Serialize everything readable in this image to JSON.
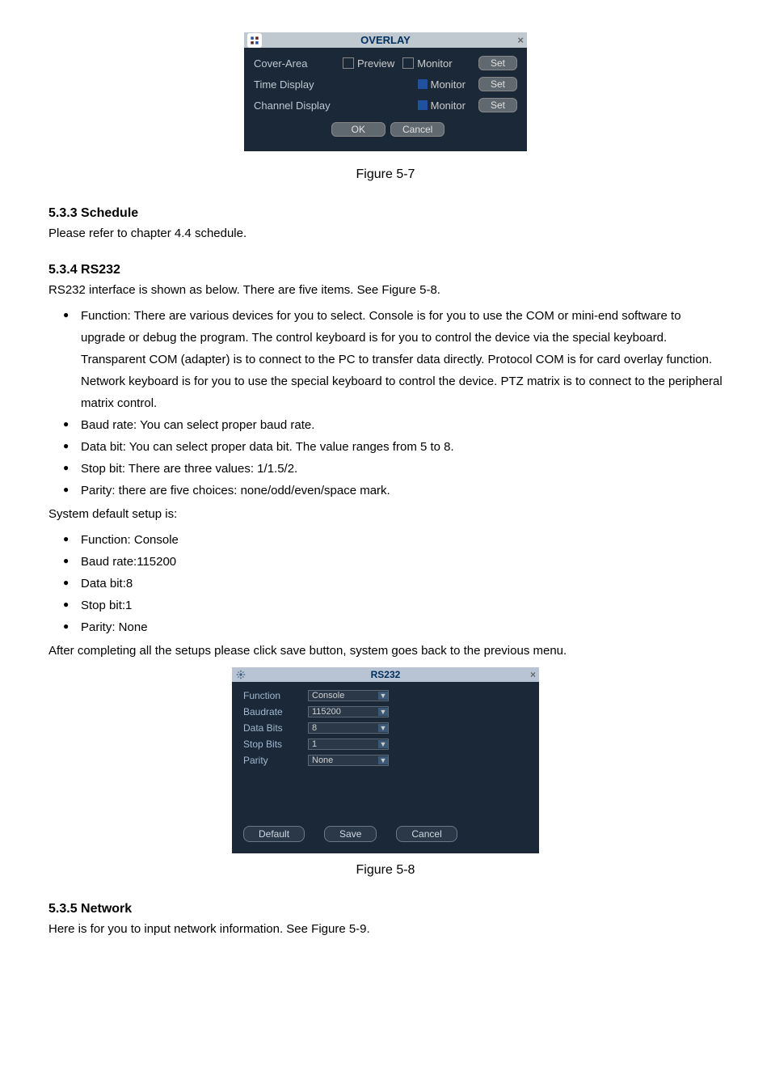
{
  "overlay_dialog": {
    "title": "OVERLAY",
    "cover_area_label": "Cover-Area",
    "preview_label": "Preview",
    "monitor_label": "Monitor",
    "time_display_label": "Time Display",
    "channel_display_label": "Channel Display",
    "set_btn": "Set",
    "ok_btn": "OK",
    "cancel_btn": "Cancel"
  },
  "caption1": "Figure 5-7",
  "s533": {
    "heading": "5.3.3  Schedule",
    "text": "Please refer to chapter 4.4 schedule."
  },
  "s534": {
    "heading": "5.3.4  RS232",
    "intro": "RS232 interface is shown as below. There are five items. See Figure 5-8.",
    "bullets": [
      "Function: There are various devices for you to select. Console is for you to use the COM or mini-end software to upgrade or debug the program. The control keyboard is for you to control the device via the special keyboard. Transparent COM (adapter) is to connect to the PC to transfer data directly. Protocol COM is for card overlay function. Network keyboard is for you to use the special keyboard to control the device. PTZ matrix is to connect to the peripheral matrix control.",
      "Baud rate: You can select proper baud rate.",
      "Data bit: You can select proper data bit. The value ranges from 5 to 8.",
      "Stop bit: There are three values: 1/1.5/2.",
      "Parity: there are five choices: none/odd/even/space mark."
    ],
    "defaults_intro": "System default setup is:",
    "defaults": [
      "Function: Console",
      "Baud rate:115200",
      "Data bit:8",
      "Stop bit:1",
      "Parity: None"
    ],
    "after": "After completing all the setups please click save button, system goes back to the previous menu."
  },
  "rs232_dialog": {
    "title": "RS232",
    "rows": {
      "function": {
        "label": "Function",
        "value": "Console"
      },
      "baudrate": {
        "label": "Baudrate",
        "value": "115200"
      },
      "databits": {
        "label": "Data Bits",
        "value": "8"
      },
      "stopbits": {
        "label": "Stop Bits",
        "value": "1"
      },
      "parity": {
        "label": "Parity",
        "value": "None"
      }
    },
    "default_btn": "Default",
    "save_btn": "Save",
    "cancel_btn": "Cancel"
  },
  "caption2": "Figure 5-8",
  "s535": {
    "heading": "5.3.5  Network",
    "text": "Here is for you to input network information. See Figure 5-9."
  }
}
